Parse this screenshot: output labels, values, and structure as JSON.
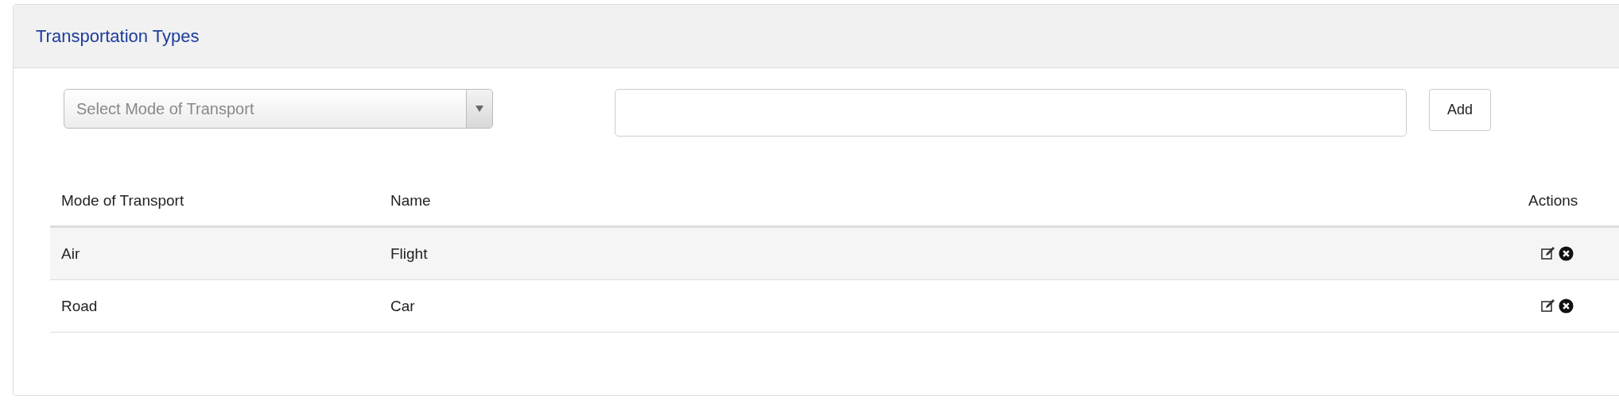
{
  "panel": {
    "title": "Transportation Types"
  },
  "form": {
    "mode_select": {
      "placeholder": "Select Mode of Transport"
    },
    "add_button": "Add"
  },
  "table": {
    "columns": [
      "Mode of Transport",
      "Name",
      "Actions"
    ],
    "rows": [
      {
        "mode": "Air",
        "name": "Flight"
      },
      {
        "mode": "Road",
        "name": "Car"
      }
    ]
  }
}
